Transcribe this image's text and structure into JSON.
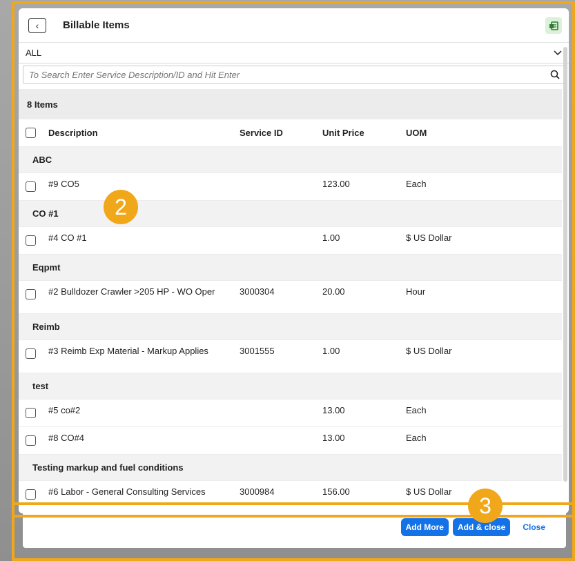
{
  "modal": {
    "title": "Billable Items",
    "filter_value": "ALL",
    "search_placeholder": "To Search Enter Service Description/ID and Hit Enter",
    "count_label": "8 Items"
  },
  "columns": {
    "description": "Description",
    "service_id": "Service ID",
    "unit_price": "Unit Price",
    "uom": "UOM"
  },
  "groups": [
    {
      "label": "ABC",
      "items": [
        {
          "description": "#9 CO5",
          "service_id": "",
          "unit_price": "123.00",
          "uom": "Each"
        }
      ]
    },
    {
      "label": "CO #1",
      "items": [
        {
          "description": "#4 CO #1",
          "service_id": "",
          "unit_price": "1.00",
          "uom": "$ US Dollar"
        }
      ]
    },
    {
      "label": "Eqpmt",
      "items": [
        {
          "description": "#2 Bulldozer Crawler >205 HP - WO Oper",
          "service_id": "3000304",
          "unit_price": "20.00",
          "uom": "Hour"
        }
      ]
    },
    {
      "label": "Reimb",
      "items": [
        {
          "description": "#3 Reimb Exp Material - Markup Applies",
          "service_id": "3001555",
          "unit_price": "1.00",
          "uom": "$ US Dollar"
        }
      ]
    },
    {
      "label": "test",
      "items": [
        {
          "description": "#5 co#2",
          "service_id": "",
          "unit_price": "13.00",
          "uom": "Each"
        },
        {
          "description": "#8 CO#4",
          "service_id": "",
          "unit_price": "13.00",
          "uom": "Each"
        }
      ]
    },
    {
      "label": "Testing markup and fuel conditions",
      "items": [
        {
          "description": "#6 Labor - General Consulting Services",
          "service_id": "3000984",
          "unit_price": "156.00",
          "uom": "$ US Dollar"
        }
      ]
    }
  ],
  "footer": {
    "add_more_label": "Add More",
    "add_close_label": "Add & close",
    "close_label": "Close"
  },
  "annotations": {
    "badge_table": "2",
    "badge_footer": "3"
  },
  "colors": {
    "highlight": "#f0a81a",
    "primary": "#1372e8"
  }
}
